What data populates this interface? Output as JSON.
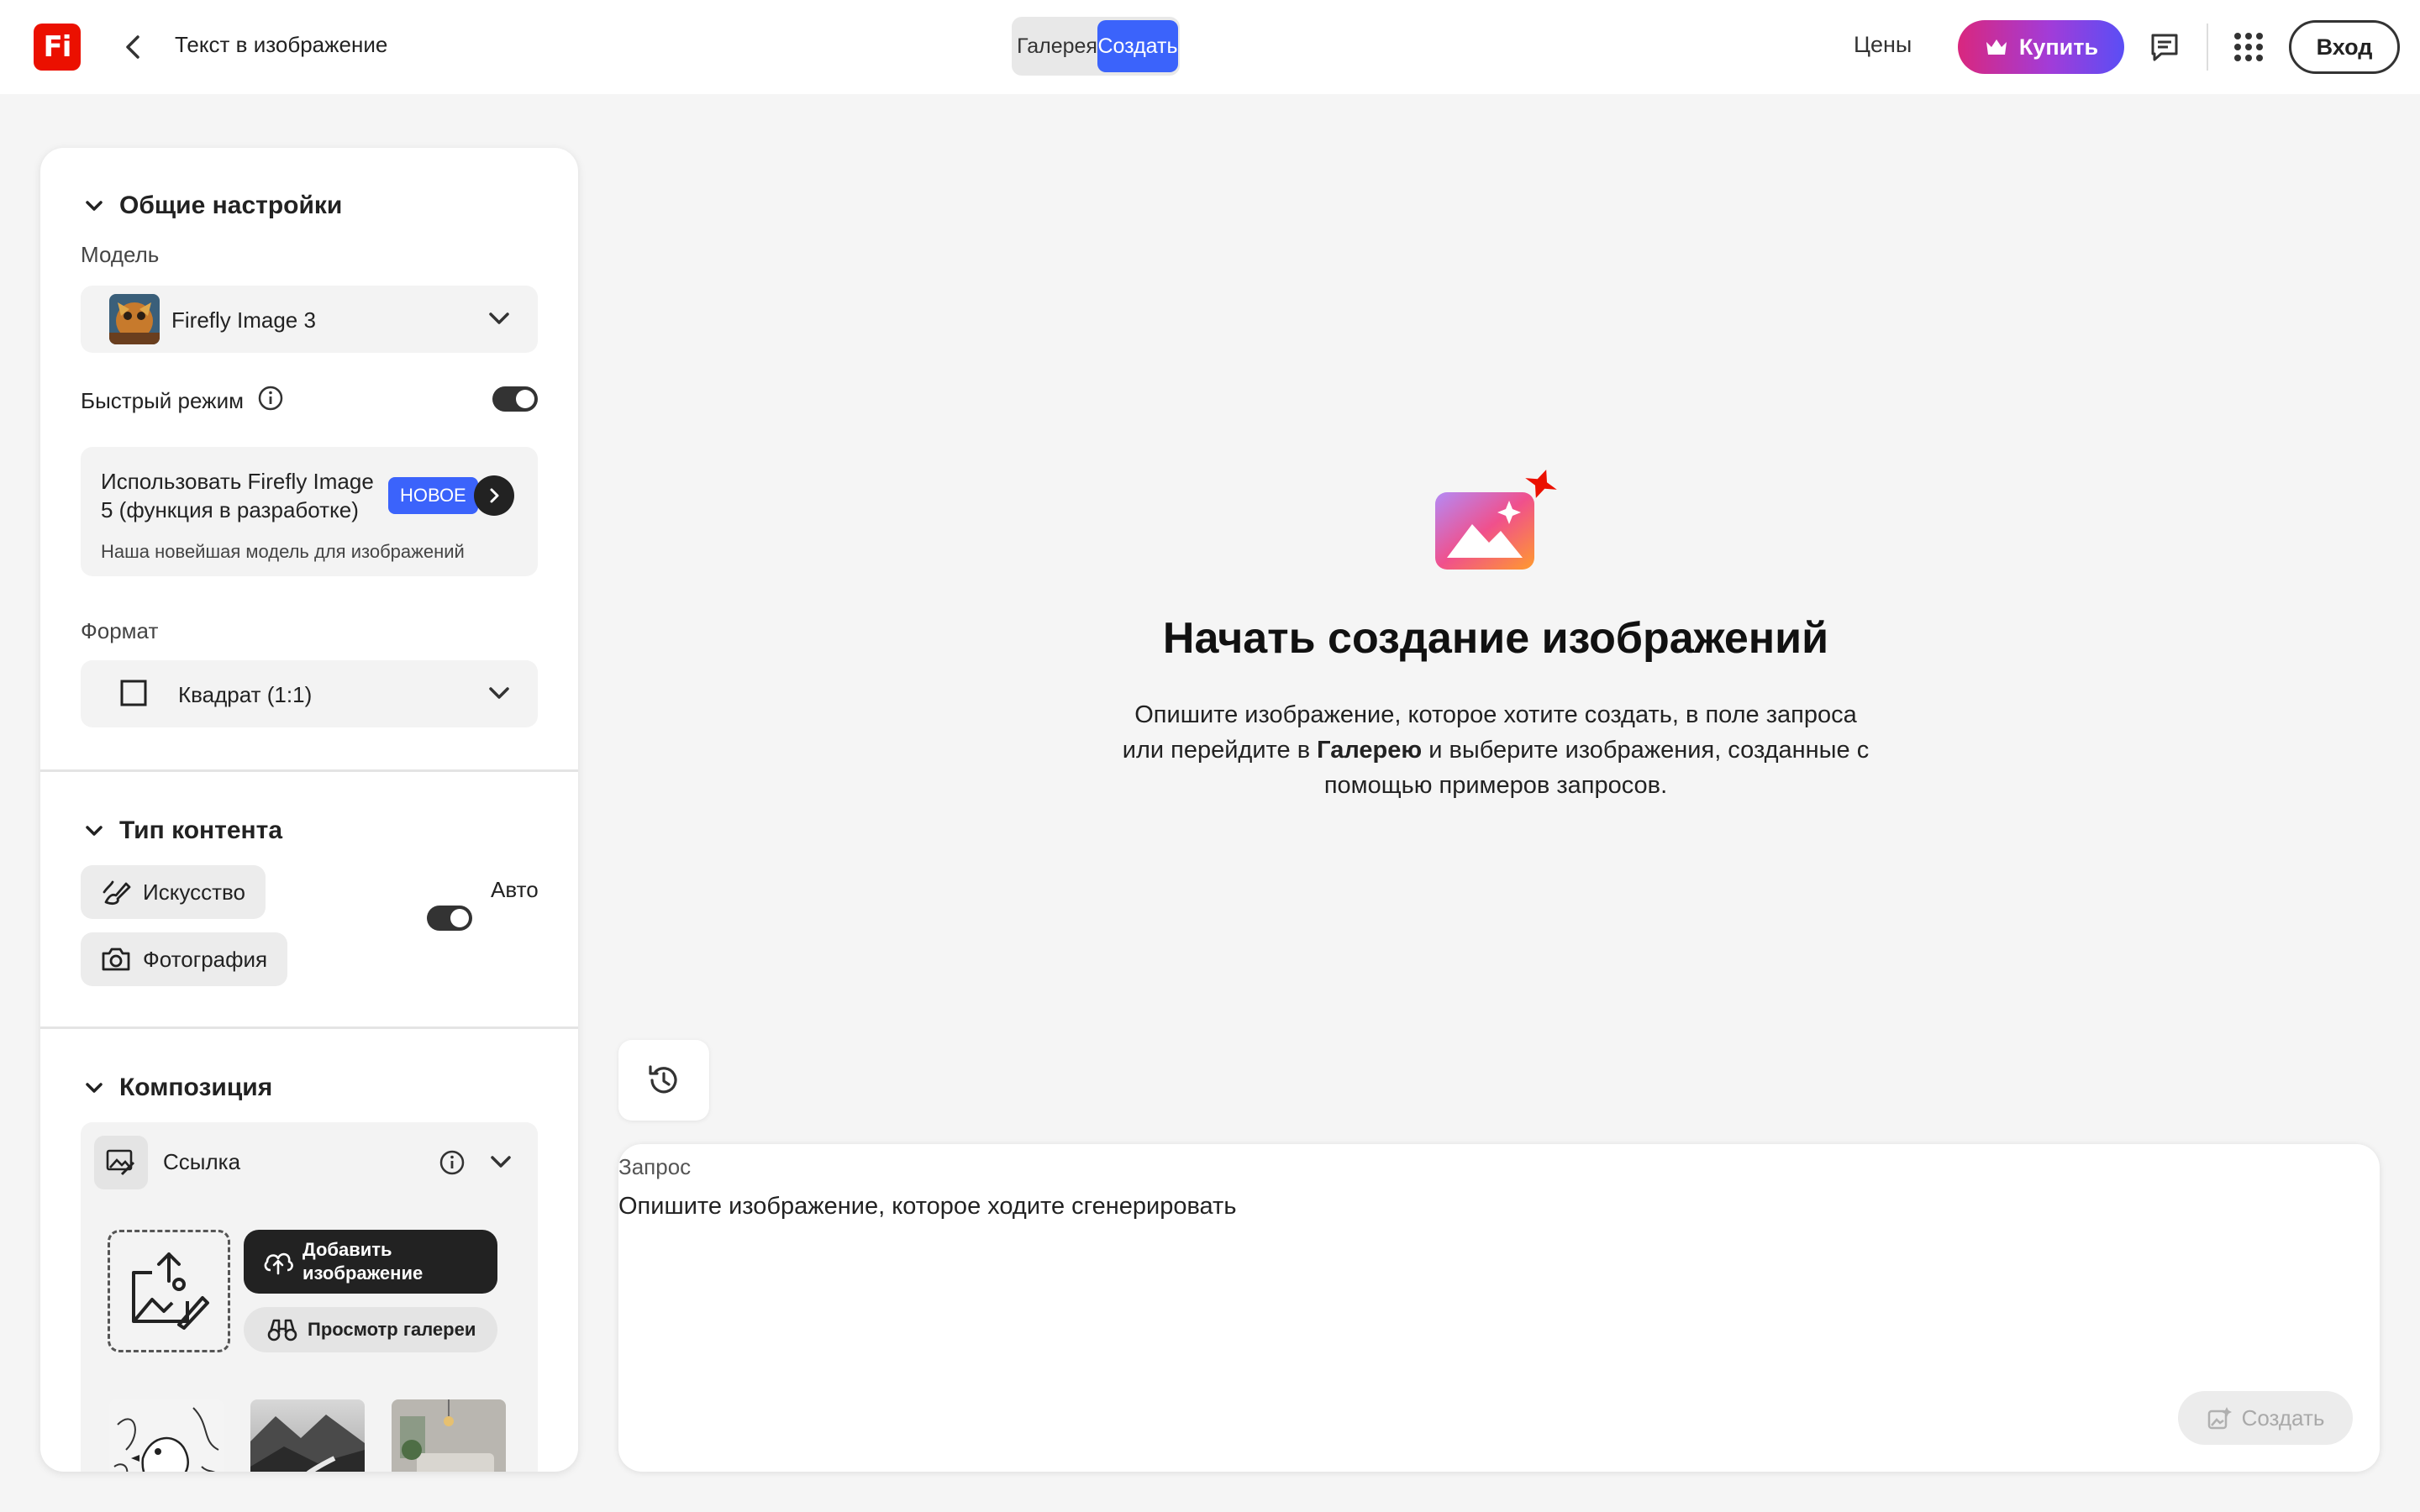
{
  "topbar": {
    "logo_text": "Fi",
    "title": "Текст в изображение",
    "tabs": {
      "gallery": "Галерея",
      "create": "Создать"
    },
    "prices": "Цены",
    "buy": "Купить",
    "login": "Вход"
  },
  "panel": {
    "general": {
      "heading": "Общие настройки",
      "model_label": "Модель",
      "model_value": "Firefly Image 3",
      "fast_mode_label": "Быстрый режим",
      "fast_mode_on": true,
      "promo_title": "Использовать Firefly Image 5 (функция в разработке)",
      "promo_badge": "НОВОЕ",
      "promo_subtitle": "Наша новейшая модель для изображений",
      "format_label": "Формат",
      "format_value": "Квадрат (1:1)"
    },
    "content_type": {
      "heading": "Тип контента",
      "art": "Искусство",
      "photo": "Фотография",
      "auto_label": "Авто",
      "auto_on": true
    },
    "composition": {
      "heading": "Композиция",
      "reference_label": "Ссылка",
      "add_image": "Добавить изображение",
      "browse_gallery": "Просмотр галереи"
    }
  },
  "main": {
    "hero_title": "Начать создание изображений",
    "hero_desc_1": "Опишите изображение, которое хотите создать, в поле запроса или перейдите в ",
    "hero_desc_bold": "Галерею",
    "hero_desc_2": " и выберите изображения, созданные с помощью примеров запросов.",
    "prompt_label": "Запрос",
    "prompt_placeholder": "Опишите изображение, которое ходите сгенерировать",
    "create_button": "Создать"
  },
  "colors": {
    "accent_blue": "#3b63fb",
    "brand_red": "#eb1000",
    "buy_gradient_start": "#d9277e",
    "buy_gradient_end": "#5a4ef5"
  },
  "icons": [
    "back-icon",
    "crown-icon",
    "chat-icon",
    "apps-grid-icon",
    "chevron-down-icon",
    "info-icon",
    "chevron-right-icon",
    "square-icon",
    "art-brush-icon",
    "camera-icon",
    "reference-icon",
    "upload-image-icon",
    "cloud-upload-icon",
    "binoculars-icon",
    "history-icon",
    "generate-icon",
    "hero-image-sparkle-icon"
  ]
}
